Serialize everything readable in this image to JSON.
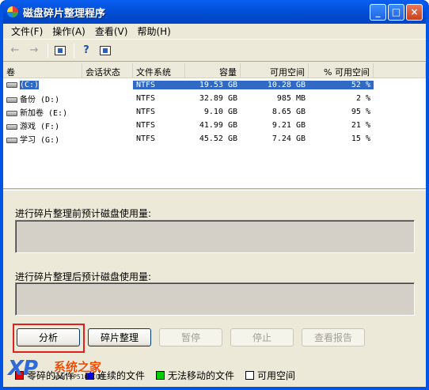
{
  "window": {
    "title": "磁盘碎片整理程序",
    "buttons": {
      "minimize": "_",
      "maximize": "□",
      "close": "×"
    }
  },
  "menu": [
    {
      "label": "文件(F)"
    },
    {
      "label": "操作(A)"
    },
    {
      "label": "查看(V)"
    },
    {
      "label": "帮助(H)"
    }
  ],
  "toolbar": {
    "back_icon": "back-arrow-icon",
    "forward_icon": "forward-arrow-icon",
    "icons": [
      "properties-icon",
      "help-icon",
      "console-tree-icon"
    ]
  },
  "list": {
    "headers": [
      "卷",
      "会话状态",
      "文件系统",
      "容量",
      "可用空间",
      "% 可用空间"
    ],
    "rows": [
      {
        "volume": "(C:)",
        "status": "",
        "fs": "NTFS",
        "capacity": "19.53 GB",
        "free": "10.28 GB",
        "pct": "52 %"
      },
      {
        "volume": "备份 (D:)",
        "status": "",
        "fs": "NTFS",
        "capacity": "32.89 GB",
        "free": "985 MB",
        "pct": "2 %"
      },
      {
        "volume": "新加卷 (E:)",
        "status": "",
        "fs": "NTFS",
        "capacity": "9.10 GB",
        "free": "8.65 GB",
        "pct": "95 %"
      },
      {
        "volume": "游戏 (F:)",
        "status": "",
        "fs": "NTFS",
        "capacity": "41.99 GB",
        "free": "9.21 GB",
        "pct": "21 %"
      },
      {
        "volume": "学习 (G:)",
        "status": "",
        "fs": "NTFS",
        "capacity": "45.52 GB",
        "free": "7.24 GB",
        "pct": "15 %"
      }
    ]
  },
  "before_label": "进行碎片整理前预计磁盘使用量:",
  "after_label": "进行碎片整理后预计磁盘使用量:",
  "buttons": {
    "analyze": "分析",
    "defrag": "碎片整理",
    "pause": "暂停",
    "stop": "停止",
    "report": "查看报告"
  },
  "legend": [
    {
      "label": "零碎的文件",
      "color": "#e60000"
    },
    {
      "label": "连续的文件",
      "color": "#0000e6"
    },
    {
      "label": "无法移动的文件",
      "color": "#00cc00"
    },
    {
      "label": "可用空间",
      "color": "#ffffff"
    }
  ],
  "watermark": {
    "logo": "XP",
    "name": "系统之家",
    "url": "WWW.XP510.COM"
  }
}
